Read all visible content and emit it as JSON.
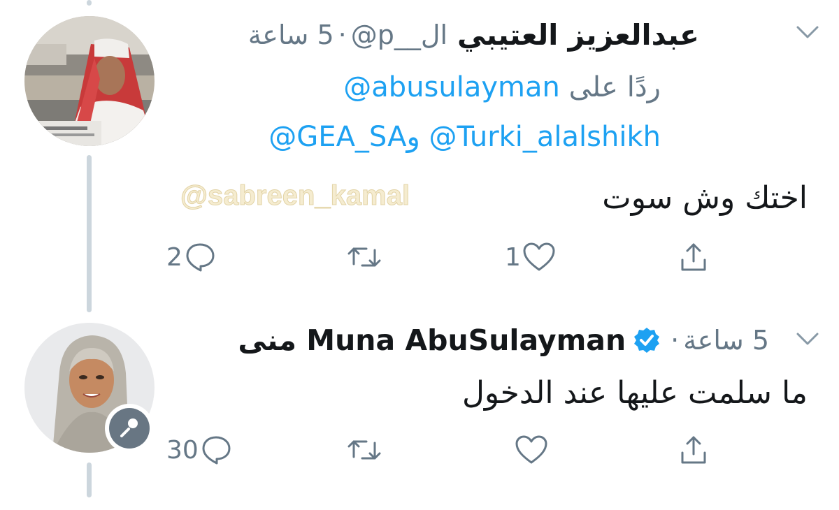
{
  "tweet1": {
    "display_name": "عبدالعزيز العتيبي",
    "handle": "@p__ال",
    "separator": "·",
    "time": "5 ساعة",
    "reply_prefix": "ردًا على",
    "reply_mention_1": "@abusulayman",
    "reply_mention_2": "@Turki_alalshikh",
    "reply_and": "و",
    "reply_mention_3": "@GEA_SA",
    "text": "اختك وش سوت",
    "watermark": "@sabreen_kamal",
    "replies": "2",
    "retweets": "",
    "likes": "1"
  },
  "tweet2": {
    "display_name": "Muna AbuSulayman منى",
    "separator": "·",
    "time": "5 ساعة",
    "verified": true,
    "text": "ما سلمت عليها عند الدخول",
    "replies": "30",
    "retweets": "",
    "likes": ""
  },
  "icons": {
    "reply": "reply-icon",
    "retweet": "retweet-icon",
    "like": "heart-icon",
    "share": "share-icon",
    "more": "chevron-down-icon",
    "verified": "verified-badge-icon",
    "mic": "microphone-icon"
  },
  "colors": {
    "link": "#1da1f2",
    "secondary_text": "#657786",
    "thread_line": "#ccd6dd"
  }
}
